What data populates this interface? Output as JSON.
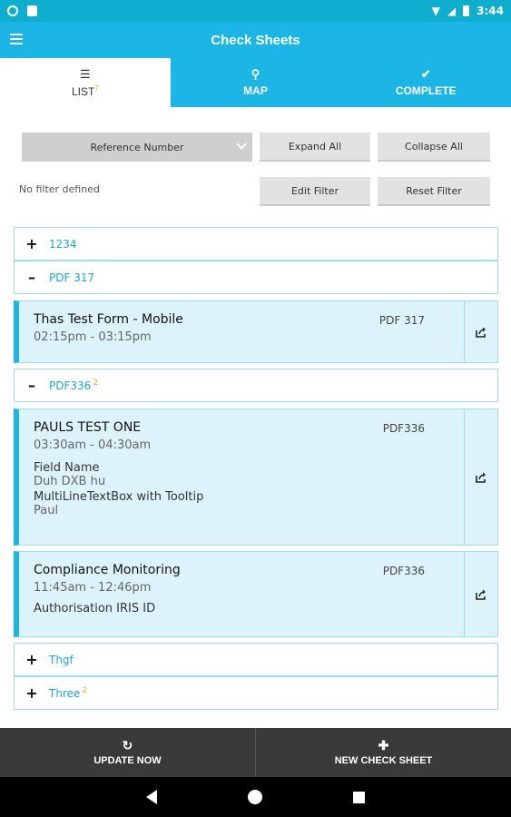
{
  "status_bar": {
    "time": "3:44"
  },
  "app_bar": {
    "title": "Check Sheets"
  },
  "tabs": [
    {
      "label": "LIST",
      "badge": "7",
      "icon": "list-icon"
    },
    {
      "label": "MAP",
      "icon": "map-pin-icon"
    },
    {
      "label": "COMPLETE",
      "icon": "check-icon"
    }
  ],
  "filters": {
    "sort_select": "Reference Number",
    "expand_all": "Expand All",
    "collapse_all": "Collapse All",
    "no_filter": "No filter defined",
    "edit_filter": "Edit Filter",
    "reset_filter": "Reset Filter"
  },
  "groups": [
    {
      "sign": "+",
      "label": "1234"
    },
    {
      "sign": "–",
      "label": "PDF 317"
    },
    {
      "sign": "–",
      "label": "PDF336",
      "badge": "2"
    },
    {
      "sign": "+",
      "label": "Thgf"
    },
    {
      "sign": "+",
      "label": "Three",
      "badge": "2"
    }
  ],
  "cards": [
    {
      "title": "Thas Test Form - Mobile",
      "time": "02:15pm - 03:15pm",
      "ref": "PDF 317"
    },
    {
      "title": "PAULS TEST ONE",
      "time": "03:30am - 04:30am",
      "ref": "PDF336",
      "fields": [
        {
          "name": "Field Name",
          "value": "Duh DXB hu"
        },
        {
          "name": "MultiLineTextBox with Tooltip",
          "value": "Paul"
        }
      ]
    },
    {
      "title": "Compliance Monitoring",
      "time": "11:45am - 12:46pm",
      "ref": "PDF336",
      "fields": [
        {
          "name": "Authorisation IRIS ID"
        }
      ]
    }
  ],
  "bottom_bar": {
    "update_now": "UPDATE NOW",
    "new_check_sheet": "NEW CHECK SHEET"
  },
  "colors": {
    "primary": "#1bb6e6",
    "card_bg": "#dcf3fb",
    "badge": "#f5a623"
  }
}
